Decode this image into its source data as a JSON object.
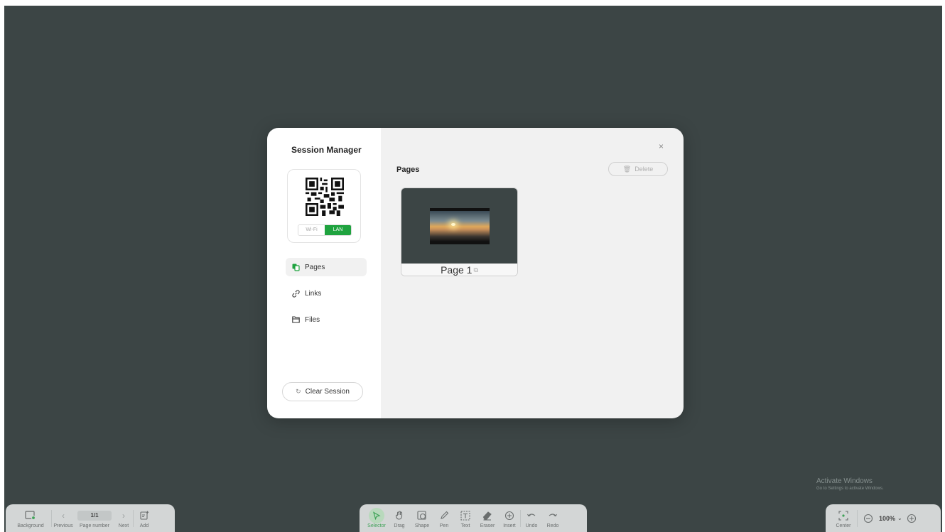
{
  "modal": {
    "title": "Session Manager",
    "toggle": {
      "wifi_label": "Wi-Fi",
      "lan_label": "LAN",
      "selected": "LAN"
    },
    "nav": [
      {
        "label": "Pages",
        "icon": "pages-icon",
        "active": true
      },
      {
        "label": "Links",
        "icon": "link-icon",
        "active": false
      },
      {
        "label": "Files",
        "icon": "folder-icon",
        "active": false
      }
    ],
    "clear_label": "Clear Session",
    "close_glyph": "×",
    "main_title": "Pages",
    "delete_label": "Delete",
    "page_thumb": {
      "label": "Page 1"
    }
  },
  "toolbar_left": {
    "background_label": "Background",
    "previous_label": "Previous",
    "page_number": "1/1",
    "page_number_label": "Page number",
    "next_label": "Next",
    "add_label": "Add"
  },
  "toolbar_center": {
    "tools": [
      {
        "label": "Selector",
        "icon": "cursor-icon",
        "active": true
      },
      {
        "label": "Drag",
        "icon": "hand-icon",
        "active": false
      },
      {
        "label": "Shape",
        "icon": "shape-icon",
        "active": false
      },
      {
        "label": "Pen",
        "icon": "pen-icon",
        "active": false
      },
      {
        "label": "Text",
        "icon": "text-icon",
        "active": false
      },
      {
        "label": "Eraser",
        "icon": "eraser-icon",
        "active": false
      },
      {
        "label": "Insert",
        "icon": "insert-icon",
        "active": false
      },
      {
        "label": "Undo",
        "icon": "undo-icon",
        "active": false
      },
      {
        "label": "Redo",
        "icon": "redo-icon",
        "active": false
      }
    ]
  },
  "toolbar_right": {
    "center_label": "Center",
    "zoom": "100%"
  },
  "watermark": {
    "line1": "Activate Windows",
    "line2": "Go to Settings to activate Windows."
  },
  "colors": {
    "canvas": "#3c4545",
    "accent": "#1fa33f",
    "toolbar": "#d3d6d6"
  }
}
